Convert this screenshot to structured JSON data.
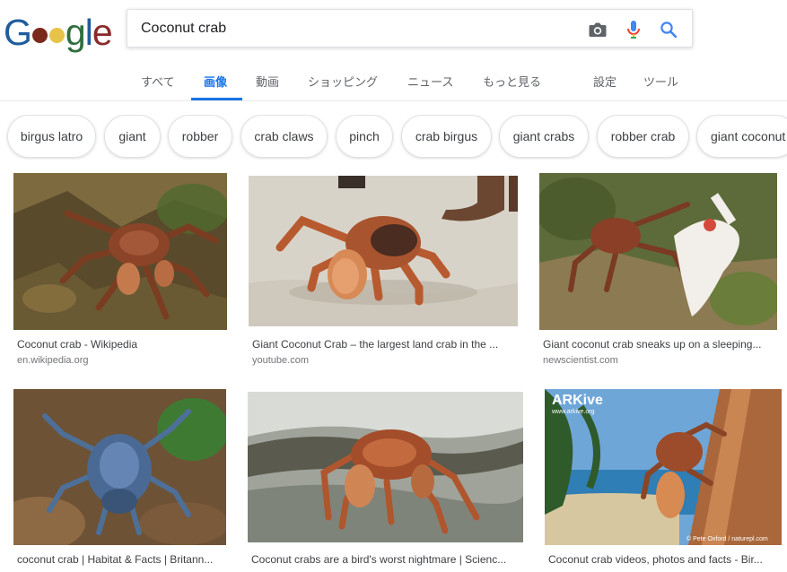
{
  "logo": {
    "letters": [
      "G",
      "g",
      "l",
      "e"
    ],
    "alt": "Google"
  },
  "search": {
    "value": "Coconut crab",
    "placeholder": ""
  },
  "icons": {
    "camera": "camera-icon",
    "mic": "mic-icon",
    "search": "search-icon"
  },
  "tabs": [
    {
      "label": "すべて"
    },
    {
      "label": "画像"
    },
    {
      "label": "動画"
    },
    {
      "label": "ショッピング"
    },
    {
      "label": "ニュース"
    },
    {
      "label": "もっと見る"
    },
    {
      "label": "設定"
    },
    {
      "label": "ツール"
    }
  ],
  "active_tab": "画像",
  "chips": [
    {
      "label": "birgus latro"
    },
    {
      "label": "giant"
    },
    {
      "label": "robber"
    },
    {
      "label": "crab claws"
    },
    {
      "label": "pinch"
    },
    {
      "label": "crab birgus"
    },
    {
      "label": "giant crabs"
    },
    {
      "label": "robber crab"
    },
    {
      "label": "giant coconut"
    }
  ],
  "results": [
    {
      "title": "Coconut crab - Wikipedia",
      "site": "en.wikipedia.org"
    },
    {
      "title": "Giant Coconut Crab – the largest land crab in the ...",
      "site": "youtube.com"
    },
    {
      "title": "Giant coconut crab sneaks up on a sleeping...",
      "site": "newscientist.com"
    },
    {
      "title": "coconut crab | Habitat & Facts | Britann...",
      "site": ""
    },
    {
      "title": "Coconut crabs are a bird's worst nightmare | Scienc...",
      "site": ""
    },
    {
      "title": "Coconut crab videos, photos and facts - Bir...",
      "site": ""
    }
  ],
  "watermarks": {
    "arkive": "ARKive",
    "arkive_url": "www.arkive.org",
    "credit": "© Pete Oxford / naturepl.com"
  },
  "colors": {
    "accent": "#1a73e8",
    "crab_orange": "#b4552a",
    "crab_blue": "#5a7fb0",
    "sand": "#dcd6cc"
  }
}
